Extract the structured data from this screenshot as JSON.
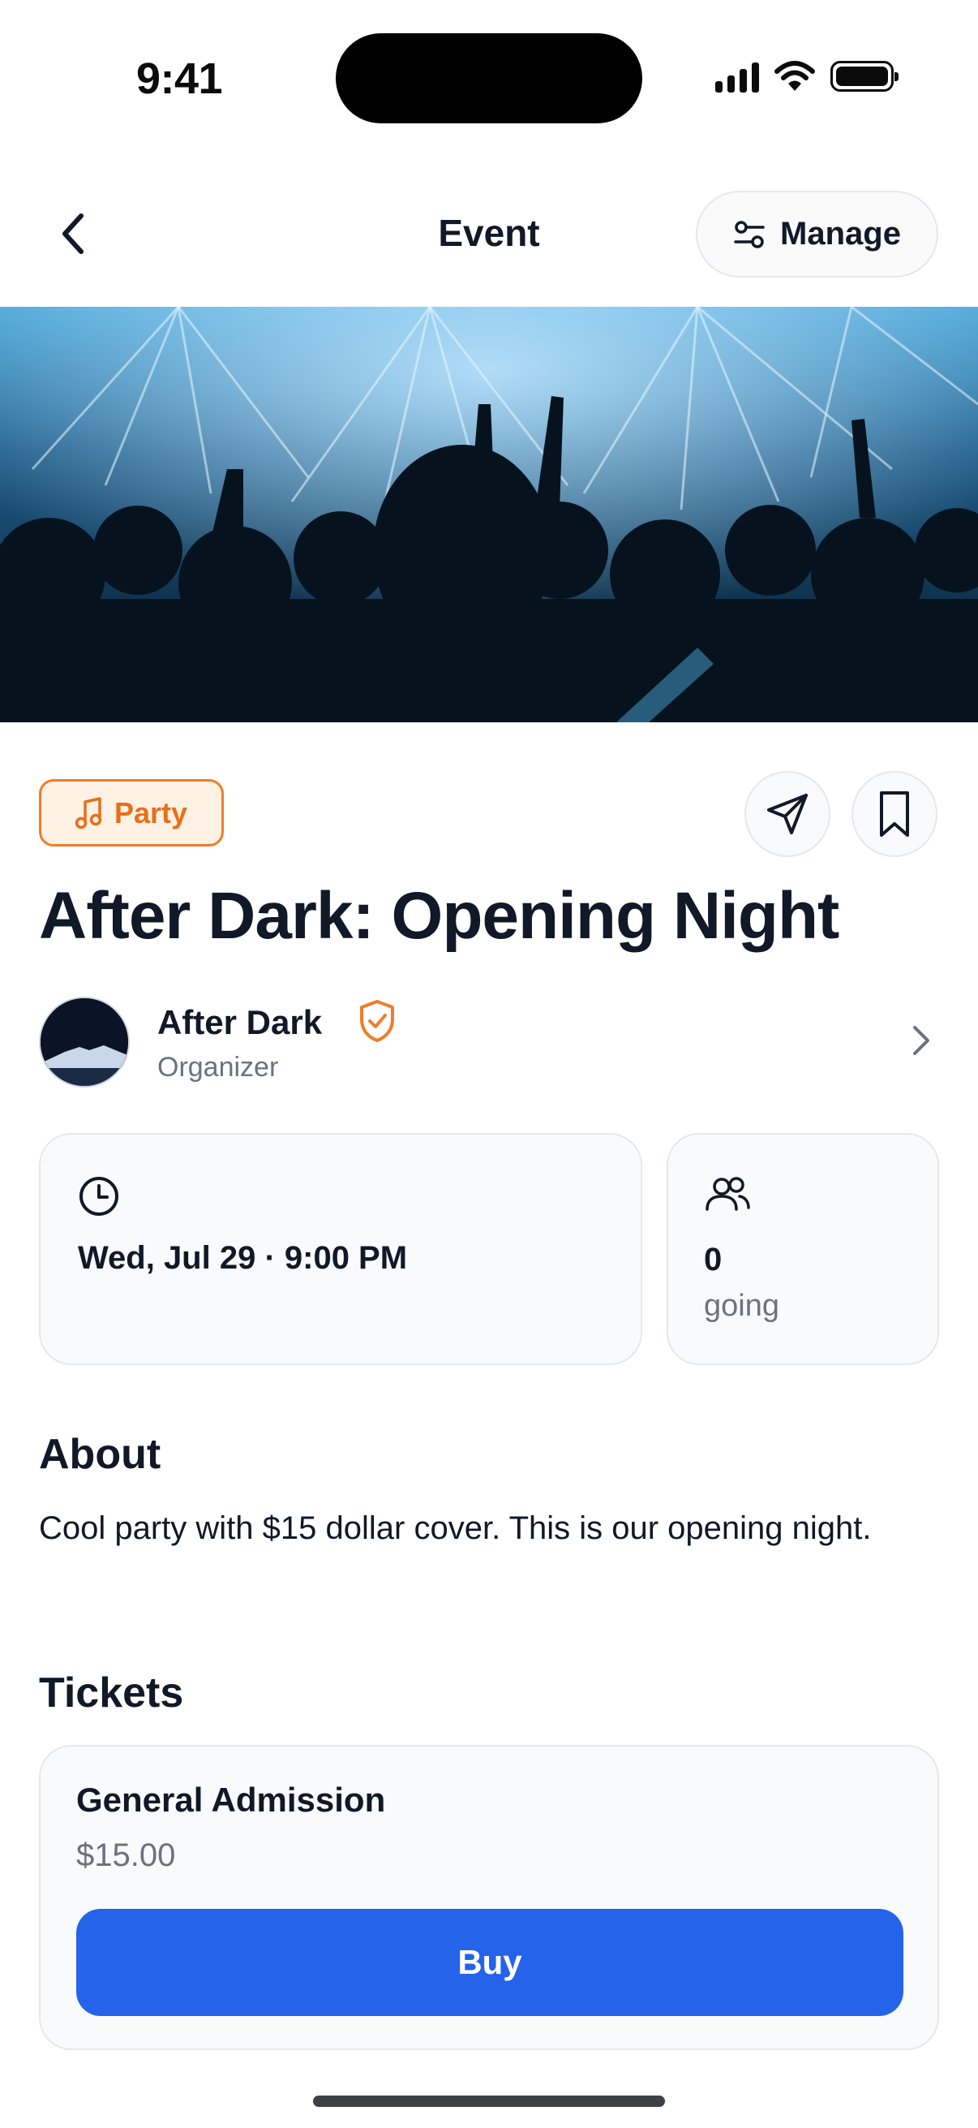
{
  "status_bar": {
    "time": "9:41"
  },
  "header": {
    "title": "Event",
    "manage_label": "Manage"
  },
  "event": {
    "category": "Party",
    "title": "After Dark: Opening Night",
    "organizer": {
      "name": "After Dark",
      "role": "Organizer"
    },
    "date_time": "Wed, Jul 29 · 9:00 PM",
    "going_count": "0",
    "going_label": "going"
  },
  "about": {
    "title": "About",
    "text": "Cool party with $15 dollar cover. This is our opening night."
  },
  "tickets": {
    "title": "Tickets",
    "items": [
      {
        "name": "General Admission",
        "price": "$15.00",
        "action": "Buy"
      }
    ]
  },
  "icons": {
    "back": "chevron-left-icon",
    "manage": "sliders-icon",
    "category": "music-note-icon",
    "share": "paper-plane-icon",
    "save": "bookmark-icon",
    "verified": "shield-check-icon",
    "organizer_link": "chevron-right-icon",
    "date": "clock-icon",
    "attendees": "users-icon"
  },
  "colors": {
    "accent": "#2563eb",
    "category": "#e86f1a",
    "category_bg": "#fff1e4",
    "verified": "#f07d2a",
    "muted_text": "#6b7280"
  }
}
